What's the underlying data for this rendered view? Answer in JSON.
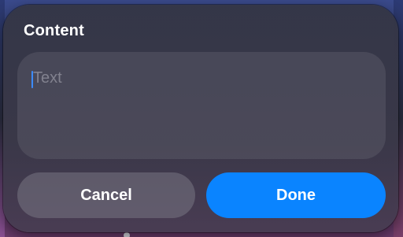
{
  "dialog": {
    "title": "Content",
    "text_field": {
      "value": "",
      "placeholder": "Text"
    },
    "cancel_label": "Cancel",
    "done_label": "Done"
  },
  "colors": {
    "accent": "#0a84ff",
    "sheet_background": "#35364a",
    "field_background": "#4a4a58",
    "cancel_background": "#5e5c6c",
    "title_text": "#ffffff"
  }
}
